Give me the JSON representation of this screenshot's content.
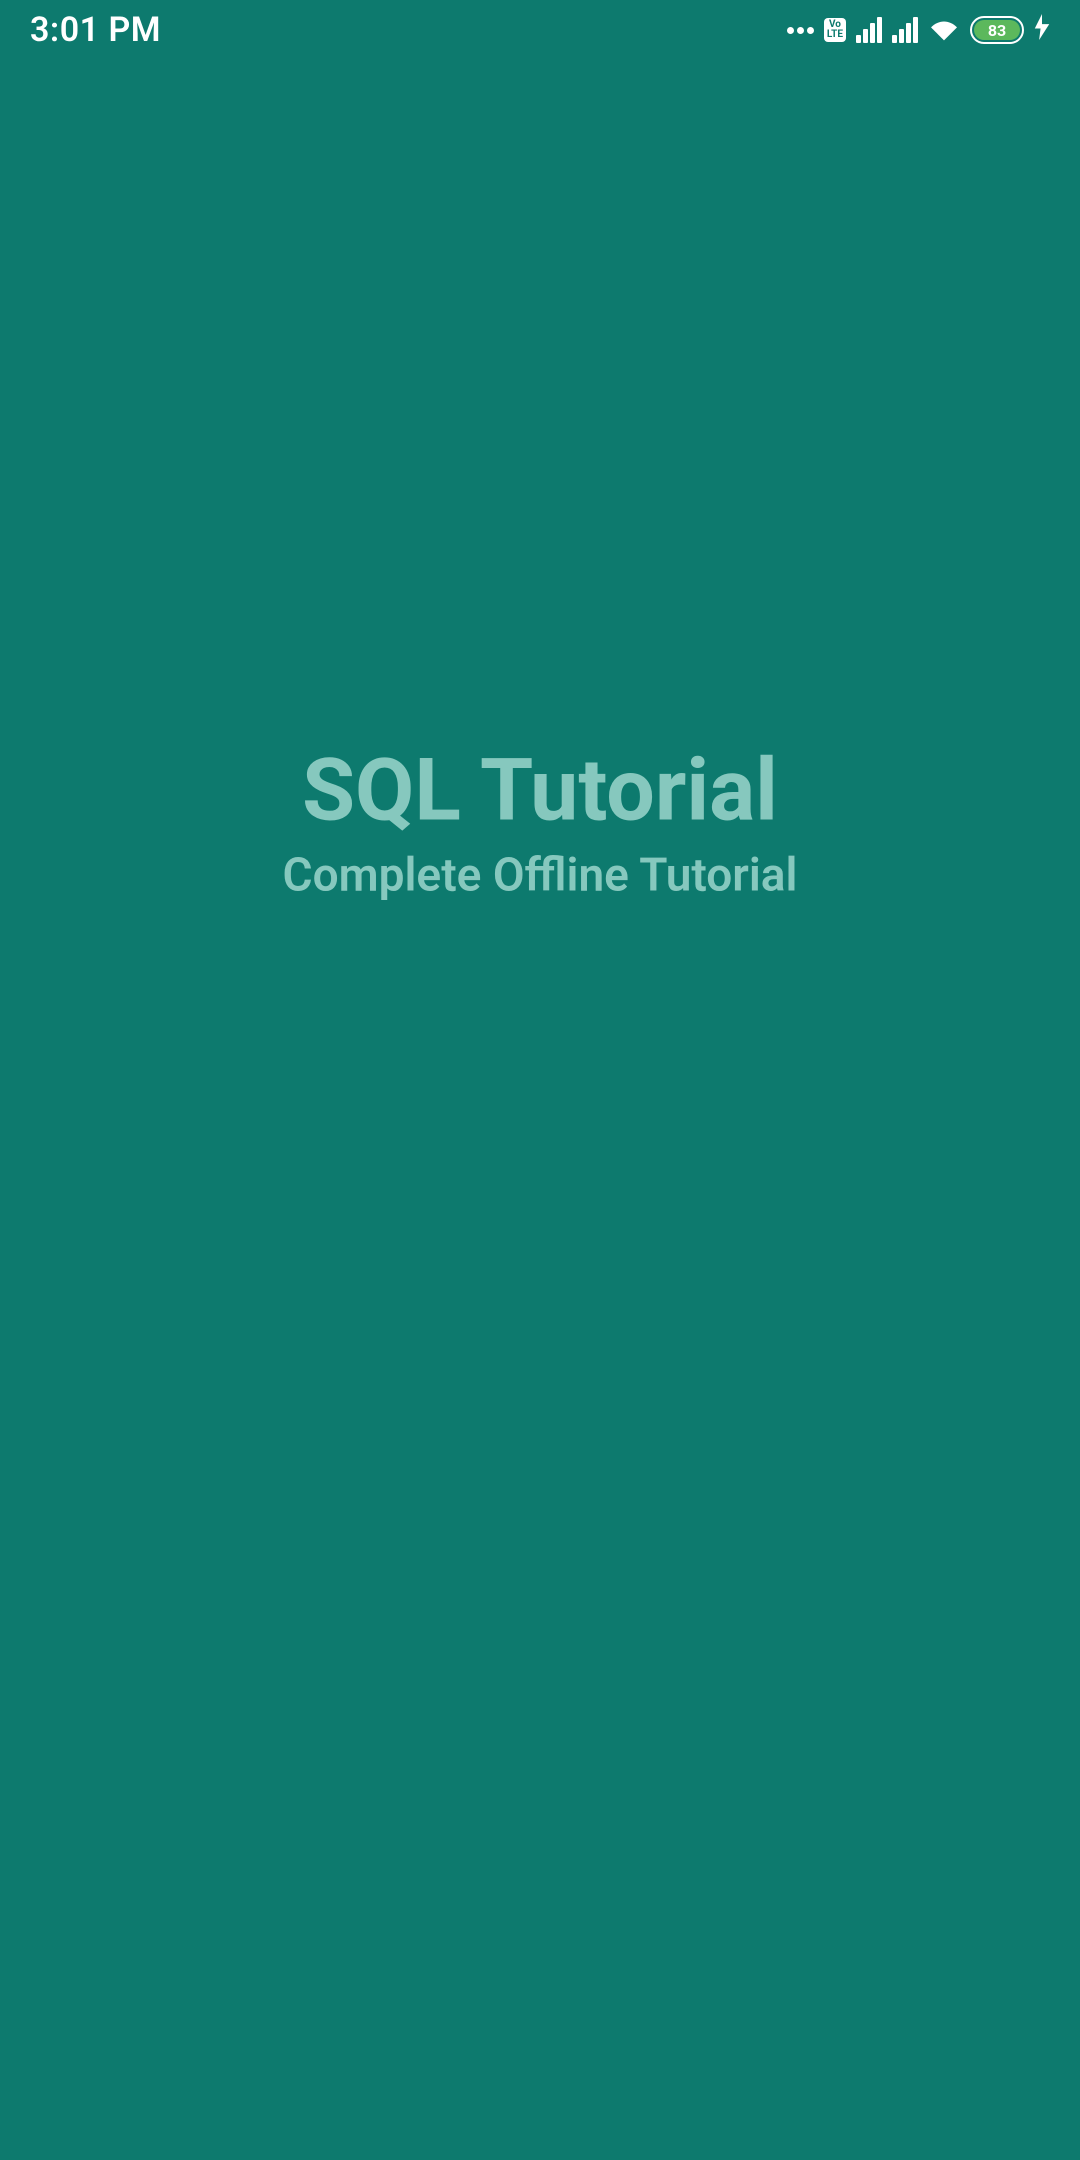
{
  "statusBar": {
    "time": "3:01 PM",
    "battery": "83"
  },
  "splash": {
    "title": "SQL Tutorial",
    "subtitle": "Complete Offline Tutorial"
  }
}
